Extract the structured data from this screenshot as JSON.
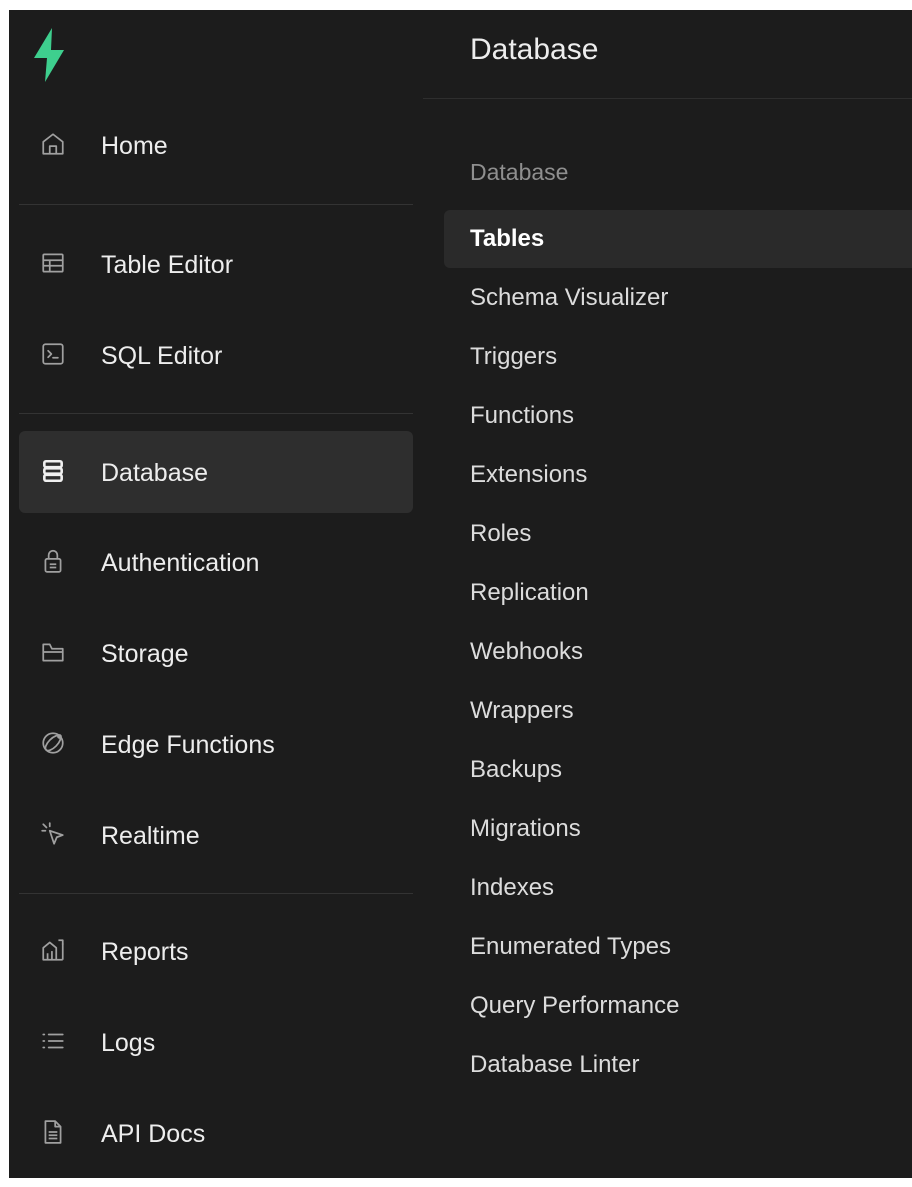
{
  "sidebar": {
    "logo_icon": "supabase-bolt-logo",
    "brand_color": "#3ecf8e",
    "items": [
      {
        "label": "Home",
        "icon": "home-icon"
      },
      {
        "label": "Table Editor",
        "icon": "table-icon"
      },
      {
        "label": "SQL Editor",
        "icon": "terminal-icon"
      },
      {
        "label": "Database",
        "icon": "database-icon",
        "active": true
      },
      {
        "label": "Authentication",
        "icon": "lock-icon"
      },
      {
        "label": "Storage",
        "icon": "archive-icon"
      },
      {
        "label": "Edge Functions",
        "icon": "globe-icon"
      },
      {
        "label": "Realtime",
        "icon": "cursor-icon"
      },
      {
        "label": "Reports",
        "icon": "chart-icon"
      },
      {
        "label": "Logs",
        "icon": "list-icon"
      },
      {
        "label": "API Docs",
        "icon": "file-icon"
      }
    ]
  },
  "panel": {
    "title": "Database",
    "section_label": "Database",
    "items": [
      {
        "label": "Tables",
        "active": true
      },
      {
        "label": "Schema Visualizer"
      },
      {
        "label": "Triggers"
      },
      {
        "label": "Functions"
      },
      {
        "label": "Extensions"
      },
      {
        "label": "Roles"
      },
      {
        "label": "Replication"
      },
      {
        "label": "Webhooks"
      },
      {
        "label": "Wrappers"
      },
      {
        "label": "Backups"
      },
      {
        "label": "Migrations"
      },
      {
        "label": "Indexes"
      },
      {
        "label": "Enumerated Types"
      },
      {
        "label": "Query Performance"
      },
      {
        "label": "Database Linter"
      }
    ]
  }
}
